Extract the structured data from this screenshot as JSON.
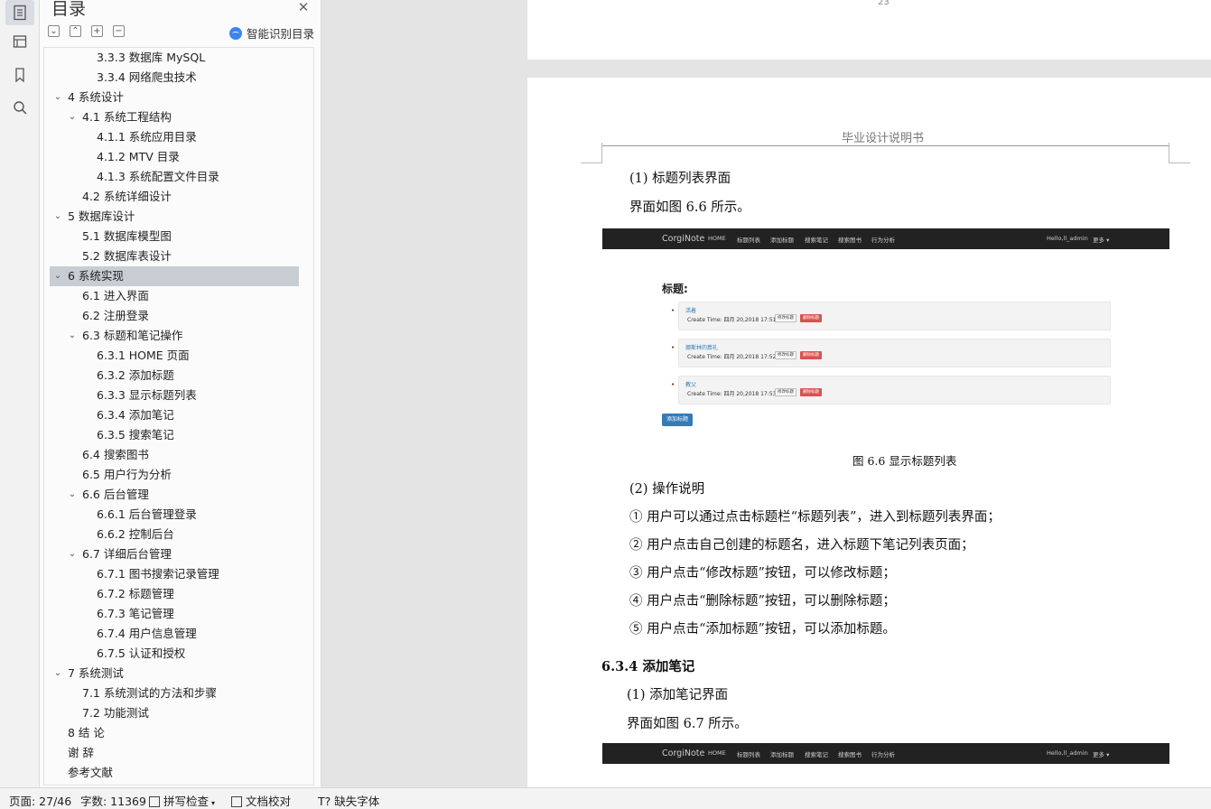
{
  "toc": {
    "title": "目录",
    "smart_toc_label": "智能识别目录",
    "items": [
      {
        "text": "3.3.3  数据库 MySQL",
        "level": 3,
        "expand": ""
      },
      {
        "text": "3.3.4  网络爬虫技术",
        "level": 3,
        "expand": ""
      },
      {
        "text": "4 系统设计",
        "level": 1,
        "expand": "open"
      },
      {
        "text": "4.1  系统工程结构",
        "level": 2,
        "expand": "open"
      },
      {
        "text": "4.1.1  系统应用目录",
        "level": 3,
        "expand": ""
      },
      {
        "text": "4.1.2 MTV 目录",
        "level": 3,
        "expand": ""
      },
      {
        "text": "4.1.3  系统配置文件目录",
        "level": 3,
        "expand": ""
      },
      {
        "text": "4.2  系统详细设计",
        "level": 2,
        "expand": ""
      },
      {
        "text": "5 数据库设计",
        "level": 1,
        "expand": "open"
      },
      {
        "text": "5.1  数据库模型图",
        "level": 2,
        "expand": ""
      },
      {
        "text": "5.2  数据库表设计",
        "level": 2,
        "expand": ""
      },
      {
        "text": "6 系统实现",
        "level": 1,
        "expand": "open",
        "selected": true
      },
      {
        "text": "6.1 进入界面",
        "level": 2,
        "expand": ""
      },
      {
        "text": "6.2 注册登录",
        "level": 2,
        "expand": ""
      },
      {
        "text": "6.3  标题和笔记操作",
        "level": 2,
        "expand": "open"
      },
      {
        "text": "6.3.1 HOME 页面",
        "level": 3,
        "expand": ""
      },
      {
        "text": "6.3.2  添加标题",
        "level": 3,
        "expand": ""
      },
      {
        "text": "6.3.3  显示标题列表",
        "level": 3,
        "expand": ""
      },
      {
        "text": "6.3.4  添加笔记",
        "level": 3,
        "expand": ""
      },
      {
        "text": "6.3.5  搜索笔记",
        "level": 3,
        "expand": ""
      },
      {
        "text": "6.4  搜索图书",
        "level": 2,
        "expand": ""
      },
      {
        "text": "6.5  用户行为分析",
        "level": 2,
        "expand": ""
      },
      {
        "text": "6.6  后台管理",
        "level": 2,
        "expand": "open"
      },
      {
        "text": "6.6.1 后台管理登录",
        "level": 3,
        "expand": ""
      },
      {
        "text": "6.6.2  控制后台",
        "level": 3,
        "expand": ""
      },
      {
        "text": "6.7  详细后台管理",
        "level": 2,
        "expand": "open"
      },
      {
        "text": "6.7.1  图书搜索记录管理",
        "level": 3,
        "expand": ""
      },
      {
        "text": "6.7.2  标题管理",
        "level": 3,
        "expand": ""
      },
      {
        "text": "6.7.3  笔记管理",
        "level": 3,
        "expand": ""
      },
      {
        "text": "6.7.4  用户信息管理",
        "level": 3,
        "expand": ""
      },
      {
        "text": "6.7.5  认证和授权",
        "level": 3,
        "expand": ""
      },
      {
        "text": "7 系统测试",
        "level": 1,
        "expand": "open"
      },
      {
        "text": "7.1  系统测试的方法和步骤",
        "level": 2,
        "expand": ""
      },
      {
        "text": "7.2  功能测试",
        "level": 2,
        "expand": ""
      },
      {
        "text": "8 结  论",
        "level": 1,
        "expand": ""
      },
      {
        "text": "谢  辞",
        "level": 1,
        "expand": ""
      },
      {
        "text": "参考文献",
        "level": 1,
        "expand": ""
      }
    ]
  },
  "document": {
    "prev_page_number": "23",
    "header": "毕业设计说明书",
    "paragraphs": [
      "(1) 标题列表界面",
      "界面如图 6.6 所示。",
      "(2) 操作说明",
      "① 用户可以通过点击标题栏“标题列表”，进入到标题列表界面；",
      "② 用户点击自己创建的标题名，进入标题下笔记列表页面；",
      "③ 用户点击“修改标题”按钮，可以修改标题；",
      "④ 用户点击“删除标题”按钮，可以删除标题；",
      "⑤ 用户点击“添加标题”按钮，可以添加标题。",
      "6.3.4  添加笔记",
      "(1) 添加笔记界面",
      "界面如图 6.7 所示。"
    ],
    "figure_caption": "图 6.6  显示标题列表",
    "figure": {
      "brand": "CorgiNote",
      "nav": [
        "HOME",
        "标题列表",
        "添加标题",
        "搜索笔记",
        "搜索图书",
        "行为分析"
      ],
      "user": "Hello,ll_admin",
      "more": "更多 ▾",
      "heading": "标题:",
      "items": [
        {
          "title": "活着",
          "time": "Create Time:  四月 20,2018 17:51"
        },
        {
          "title": "挪斯林的葬礼",
          "time": "Create Time:  四月 20,2018 17:52"
        },
        {
          "title": "教父",
          "time": "Create Time:  四月 20,2018 17:53"
        }
      ],
      "edit_label": "修改标题",
      "delete_label": "删除标题",
      "add_label": "添加标题"
    }
  },
  "status_bar": {
    "page": "页面: 27/46",
    "words": "字数: 11369",
    "spell_check": "拼写检查",
    "proofread": "文档校对",
    "missing_fonts": "缺失字体"
  }
}
